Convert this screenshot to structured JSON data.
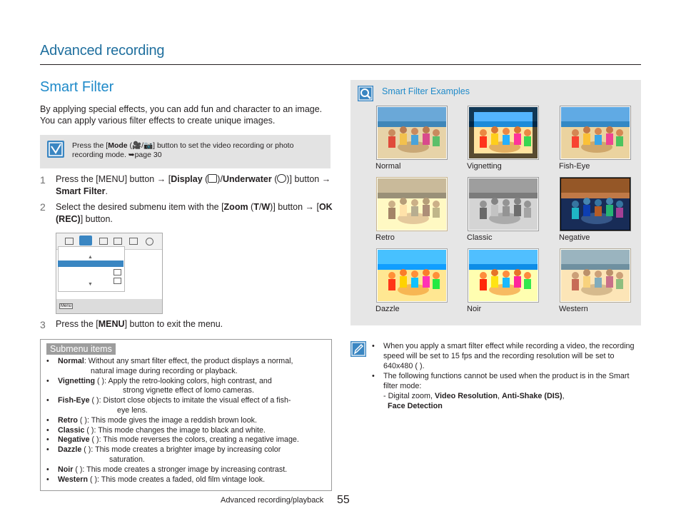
{
  "header": {
    "section": "Advanced recording"
  },
  "title": "Smart Filter",
  "intro": "By applying special effects, you can add fun and character to an image. You can apply various filter effects to create unique images.",
  "note": {
    "pre": "Press the [",
    "mode": "Mode",
    "mid": "] button to set the video recording or photo recording mode. ",
    "page": "➥page 30"
  },
  "steps": [
    {
      "num": "1",
      "a": "Press the [",
      "menu": "MENU",
      "b": "] button → [",
      "display": "Display",
      "c": " (",
      "d": ")/",
      "underwater": "Underwater",
      "e": " (",
      "f": ")] button → ",
      "smart": "Smart Filter",
      "g": "."
    },
    {
      "num": "2",
      "a": "Select the desired submenu item with the [",
      "zoom": "Zoom",
      "b": " (",
      "t": "T",
      "slash": "/",
      "w": "W",
      "c": ")] button → [",
      "ok": "OK (REC)",
      "d": "] button."
    },
    {
      "num": "3",
      "a": "Press the [",
      "menu": "MENU",
      "b": "] button to exit the menu."
    }
  ],
  "menu_ui": {
    "menu_label": "Menu"
  },
  "submenu": {
    "tag": "Submenu items",
    "items": [
      {
        "name": "Normal",
        "text": ": Without any smart filter effect, the product displays a normal,",
        "cont": "natural image during recording or playback."
      },
      {
        "name": "Vignetting",
        "text": " (    ): Apply the retro-looking colors, high contrast, and",
        "cont": "strong vignette effect of lomo cameras."
      },
      {
        "name": "Fish-Eye",
        "text": " (    ): Distort close objects to imitate the visual effect of a fish-",
        "cont": "eye lens."
      },
      {
        "name": "Retro",
        "text": " (    ): This mode gives the image a reddish brown look.",
        "cont": ""
      },
      {
        "name": "Classic",
        "text": " (    ): This mode changes the image to black and white.",
        "cont": ""
      },
      {
        "name": "Negative",
        "text": " (    ): This mode reverses the colors, creating a negative image.",
        "cont": ""
      },
      {
        "name": "Dazzle",
        "text": " (    ): This mode creates a brighter image by increasing color",
        "cont": "saturation."
      },
      {
        "name": "Noir",
        "text": " (    ): This mode creates a stronger image by increasing contrast.",
        "cont": ""
      },
      {
        "name": "Western",
        "text": " (    ): This mode creates a faded, old film vintage look.",
        "cont": ""
      }
    ]
  },
  "examples": {
    "title": "Smart Filter Examples",
    "items": [
      {
        "label": "Normal",
        "filter": "none"
      },
      {
        "label": "Vignetting",
        "filter": "vignette"
      },
      {
        "label": "Fish-Eye",
        "filter": "fisheye"
      },
      {
        "label": "Retro",
        "filter": "sepia"
      },
      {
        "label": "Classic",
        "filter": "grayscale"
      },
      {
        "label": "Negative",
        "filter": "invert"
      },
      {
        "label": "Dazzle",
        "filter": "saturate"
      },
      {
        "label": "Noir",
        "filter": "contrast"
      },
      {
        "label": "Western",
        "filter": "faded"
      }
    ]
  },
  "notes2": {
    "b1": "When you apply a smart filter effect while recording a video, the recording speed will be set to 15 fps and the recording resolution will be set to 640x480 (    ).",
    "b2": "The following functions cannot be used when the product is in the Smart filter mode:",
    "b2_pre": "- Digital zoom, ",
    "vr": "Video Resolution",
    "comma": ", ",
    "as": "Anti-Shake (DIS)",
    "comma2": ",",
    "fd": "Face Detection"
  },
  "footer": {
    "text": "Advanced recording/playback",
    "page": "55"
  },
  "colors": {
    "accent": "#1f8ac9",
    "panel": "#e6e6e6",
    "note": "#e3e3e3"
  }
}
